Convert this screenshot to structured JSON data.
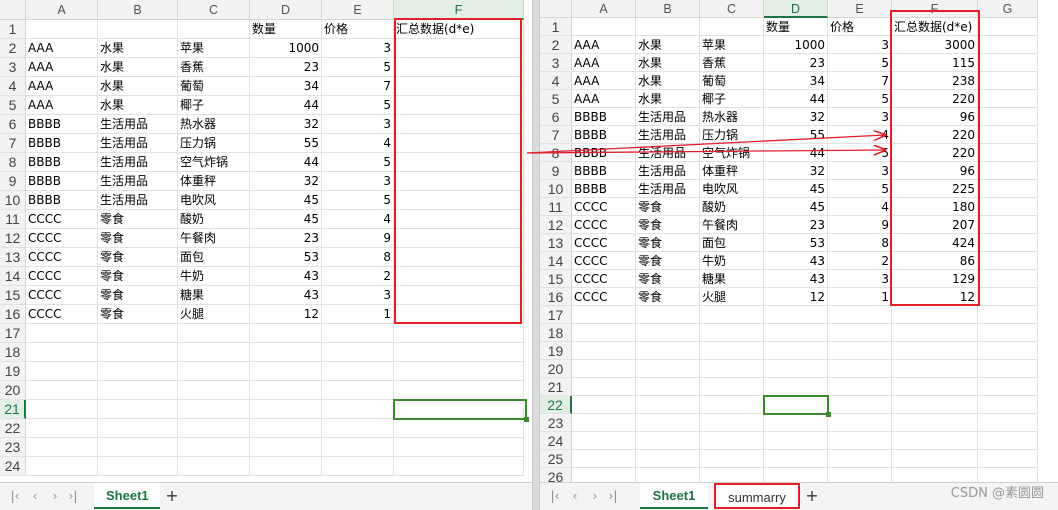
{
  "left": {
    "columns": [
      "A",
      "B",
      "C",
      "D",
      "E",
      "F"
    ],
    "selected_column": "F",
    "selected_row": "21",
    "row_numbers": [
      "1",
      "2",
      "3",
      "4",
      "5",
      "6",
      "7",
      "8",
      "9",
      "10",
      "11",
      "12",
      "13",
      "14",
      "15",
      "16",
      "17",
      "18",
      "19",
      "20",
      "21",
      "22",
      "23",
      "24"
    ],
    "header_row": [
      "",
      "",
      "",
      "数量",
      "价格",
      "汇总数据(d*e)"
    ],
    "rows": [
      [
        "AAA",
        "水果",
        "苹果",
        "1000",
        "3",
        ""
      ],
      [
        "AAA",
        "水果",
        "香蕉",
        "23",
        "5",
        ""
      ],
      [
        "AAA",
        "水果",
        "葡萄",
        "34",
        "7",
        ""
      ],
      [
        "AAA",
        "水果",
        "椰子",
        "44",
        "5",
        ""
      ],
      [
        "BBBB",
        "生活用品",
        "热水器",
        "32",
        "3",
        ""
      ],
      [
        "BBBB",
        "生活用品",
        "压力锅",
        "55",
        "4",
        ""
      ],
      [
        "BBBB",
        "生活用品",
        "空气炸锅",
        "44",
        "5",
        ""
      ],
      [
        "BBBB",
        "生活用品",
        "体重秤",
        "32",
        "3",
        ""
      ],
      [
        "BBBB",
        "生活用品",
        "电吹风",
        "45",
        "5",
        ""
      ],
      [
        "CCCC",
        "零食",
        "酸奶",
        "45",
        "4",
        ""
      ],
      [
        "CCCC",
        "零食",
        "午餐肉",
        "23",
        "9",
        ""
      ],
      [
        "CCCC",
        "零食",
        "面包",
        "53",
        "8",
        ""
      ],
      [
        "CCCC",
        "零食",
        "牛奶",
        "43",
        "2",
        ""
      ],
      [
        "CCCC",
        "零食",
        "糖果",
        "43",
        "3",
        ""
      ],
      [
        "CCCC",
        "零食",
        "火腿",
        "12",
        "1",
        ""
      ]
    ],
    "tabs": [
      {
        "label": "Sheet1",
        "active": true
      }
    ],
    "add_tab": "+"
  },
  "right": {
    "columns": [
      "A",
      "B",
      "C",
      "D",
      "E",
      "F",
      "G"
    ],
    "selected_column": "D",
    "selected_row": "22",
    "row_numbers": [
      "1",
      "2",
      "3",
      "4",
      "5",
      "6",
      "7",
      "8",
      "9",
      "10",
      "11",
      "12",
      "13",
      "14",
      "15",
      "16",
      "17",
      "18",
      "19",
      "20",
      "21",
      "22",
      "23",
      "24",
      "25",
      "26"
    ],
    "header_row": [
      "",
      "",
      "",
      "数量",
      "价格",
      "汇总数据(d*e)",
      ""
    ],
    "rows": [
      [
        "AAA",
        "水果",
        "苹果",
        "1000",
        "3",
        "3000",
        ""
      ],
      [
        "AAA",
        "水果",
        "香蕉",
        "23",
        "5",
        "115",
        ""
      ],
      [
        "AAA",
        "水果",
        "葡萄",
        "34",
        "7",
        "238",
        ""
      ],
      [
        "AAA",
        "水果",
        "椰子",
        "44",
        "5",
        "220",
        ""
      ],
      [
        "BBBB",
        "生活用品",
        "热水器",
        "32",
        "3",
        "96",
        ""
      ],
      [
        "BBBB",
        "生活用品",
        "压力锅",
        "55",
        "4",
        "220",
        ""
      ],
      [
        "BBBB",
        "生活用品",
        "空气炸锅",
        "44",
        "5",
        "220",
        ""
      ],
      [
        "BBBB",
        "生活用品",
        "体重秤",
        "32",
        "3",
        "96",
        ""
      ],
      [
        "BBBB",
        "生活用品",
        "电吹风",
        "45",
        "5",
        "225",
        ""
      ],
      [
        "CCCC",
        "零食",
        "酸奶",
        "45",
        "4",
        "180",
        ""
      ],
      [
        "CCCC",
        "零食",
        "午餐肉",
        "23",
        "9",
        "207",
        ""
      ],
      [
        "CCCC",
        "零食",
        "面包",
        "53",
        "8",
        "424",
        ""
      ],
      [
        "CCCC",
        "零食",
        "牛奶",
        "43",
        "2",
        "86",
        ""
      ],
      [
        "CCCC",
        "零食",
        "糖果",
        "43",
        "3",
        "129",
        ""
      ],
      [
        "CCCC",
        "零食",
        "火腿",
        "12",
        "1",
        "12",
        ""
      ]
    ],
    "tabs": [
      {
        "label": "Sheet1",
        "active": true
      },
      {
        "label": "summarry",
        "active": false
      }
    ],
    "add_tab": "+"
  },
  "nav_icons": [
    "first-sheet-icon",
    "prev-sheet-icon",
    "next-sheet-icon",
    "last-sheet-icon"
  ],
  "nav_glyphs": [
    "|‹",
    "‹",
    "›",
    "›|"
  ],
  "watermark": "CSDN @素圆圆",
  "colors": {
    "highlight_box": "#e0202a",
    "selection": "#3c8a2e",
    "active_tab": "#217346"
  }
}
